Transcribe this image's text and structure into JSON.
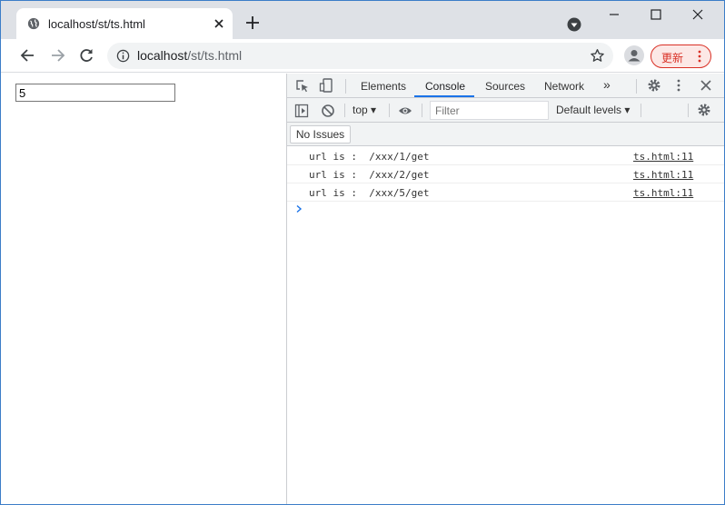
{
  "browser": {
    "tab": {
      "title": "localhost/st/ts.html"
    },
    "omnibox": {
      "host": "localhost",
      "path": "/st/ts.html"
    },
    "update_label": "更新",
    "icons": {
      "favicon": "globe-icon",
      "tab_close": "close-icon",
      "new_tab": "plus-icon",
      "tab_search": "tab-search-icon",
      "back": "back-arrow-icon",
      "forward": "forward-arrow-icon",
      "reload": "reload-icon",
      "site_info": "info-icon",
      "bookmark": "star-icon",
      "profile": "profile-icon",
      "menu": "kebab-menu-icon"
    }
  },
  "page": {
    "input_value": "5"
  },
  "devtools": {
    "tabs": [
      {
        "label": "Elements"
      },
      {
        "label": "Console"
      },
      {
        "label": "Sources"
      },
      {
        "label": "Network"
      }
    ],
    "more_tabs": "»",
    "toolbar": {
      "context": "top",
      "filter_placeholder": "Filter",
      "levels": "Default levels"
    },
    "issues_label": "No Issues",
    "console": [
      {
        "message": "url is :  /xxx/1/get",
        "source": "ts.html:11"
      },
      {
        "message": "url is :  /xxx/2/get",
        "source": "ts.html:11"
      },
      {
        "message": "url is :  /xxx/5/get",
        "source": "ts.html:11"
      }
    ]
  },
  "colors": {
    "accent": "#1a73e8",
    "update_red": "#d93025",
    "tabstrip_bg": "#dee1e6"
  }
}
